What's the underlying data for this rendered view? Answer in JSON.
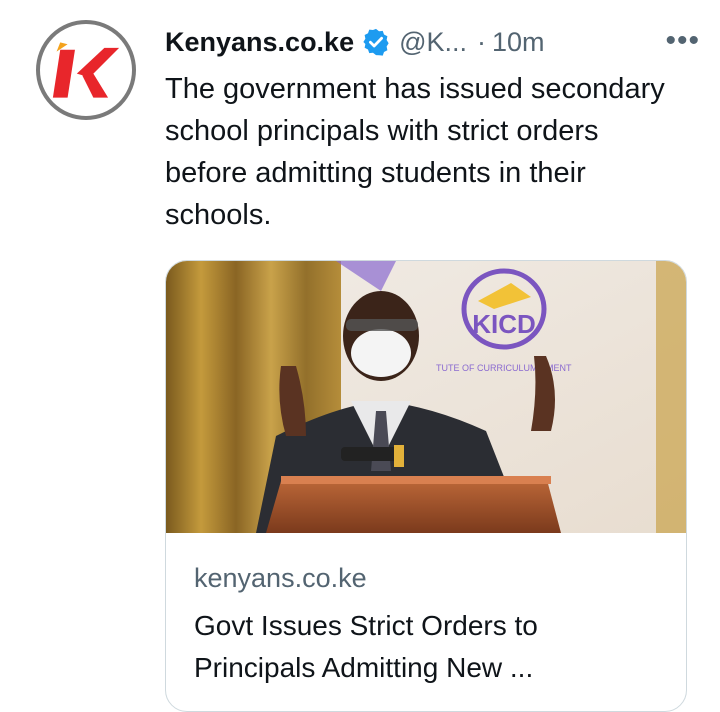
{
  "tweet": {
    "author_name": "Kenyans.co.ke",
    "handle": "@K...",
    "separator": "·",
    "time": "10m",
    "more_label": "•••",
    "text": "The government has issued secondary school principals with strict orders before admitting students in their schools."
  },
  "avatar": {
    "icon": "kenyans-logo",
    "letter": "K"
  },
  "verified_icon": "verified-badge-icon",
  "card": {
    "image_logo_text": "KICD",
    "image_banner_text": "TUTE OF CURRICULUM   PMENT",
    "domain": "kenyans.co.ke",
    "title": "Govt Issues Strict Orders to Principals Admitting New ..."
  },
  "colors": {
    "text_primary": "#0f1419",
    "text_secondary": "#536471",
    "verified": "#1d9bf0",
    "logo_red": "#e8262b",
    "border": "#cfd9de"
  }
}
